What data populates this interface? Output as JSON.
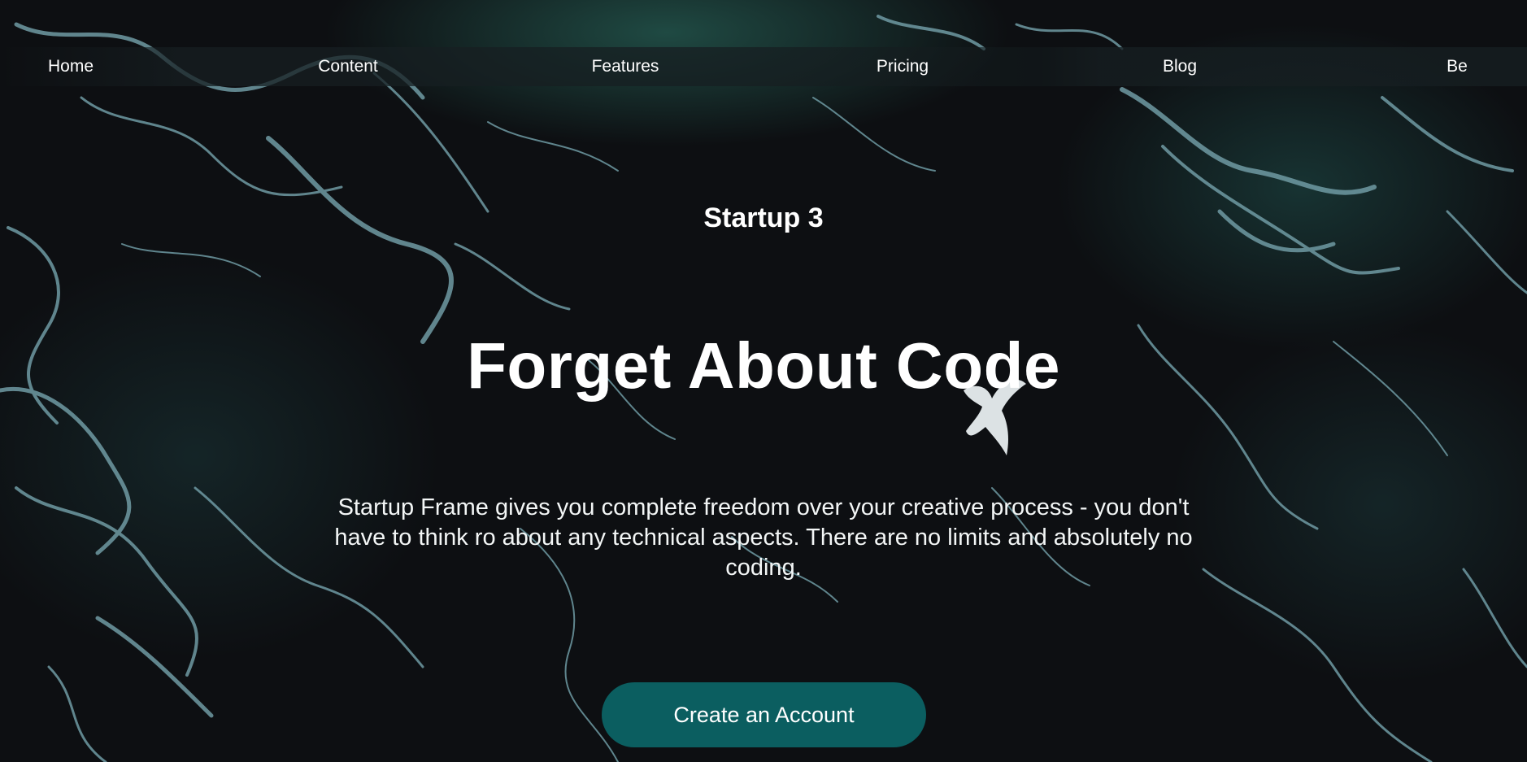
{
  "nav": {
    "items": [
      {
        "label": "Home"
      },
      {
        "label": "Content"
      },
      {
        "label": "Features"
      },
      {
        "label": "Pricing"
      },
      {
        "label": "Blog"
      },
      {
        "label": "Be"
      }
    ]
  },
  "hero": {
    "eyebrow": "Startup 3",
    "headline": "Forget About Code",
    "description": "Startup Frame gives you complete freedom over your creative process - you don't have to think ro about any technical aspects. There are no limits and absolutely no coding.",
    "cta_label": "Create an Account"
  },
  "colors": {
    "background": "#0d0f12",
    "foam": "#6f9aa3",
    "accent_glow": "#2e7a6b",
    "cta": "#0b5e60",
    "text": "#ffffff"
  },
  "icons": {
    "bird": "seagull-illustration"
  }
}
